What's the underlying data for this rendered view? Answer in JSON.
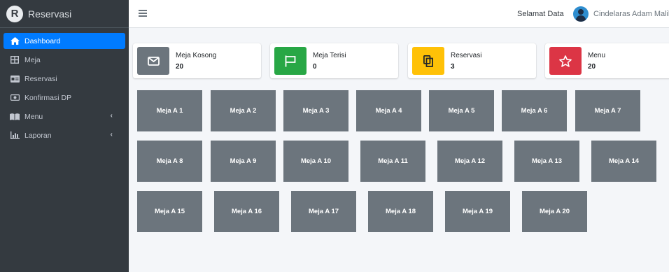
{
  "brand": {
    "logo_letter": "R",
    "name": "Reservasi"
  },
  "sidebar": {
    "items": [
      {
        "label": "Dashboard",
        "icon": "home-icon",
        "active": true
      },
      {
        "label": "Meja",
        "icon": "table-grid-icon"
      },
      {
        "label": "Reservasi",
        "icon": "id-card-icon"
      },
      {
        "label": "Konfirmasi DP",
        "icon": "money-icon"
      },
      {
        "label": "Menu",
        "icon": "book-icon",
        "chevron": "‹"
      },
      {
        "label": "Laporan",
        "icon": "chart-icon",
        "chevron": "‹"
      }
    ]
  },
  "header": {
    "greeting": "Selamat Data",
    "username": "Cindelaras Adam Malik"
  },
  "info_boxes": [
    {
      "label": "Meja Kosong",
      "value": "20",
      "icon": "envelope-icon",
      "color": "#6c757d"
    },
    {
      "label": "Meja Terisi",
      "value": "0",
      "icon": "flag-icon",
      "color": "#28a745"
    },
    {
      "label": "Reservasi",
      "value": "3",
      "icon": "copy-icon",
      "color": "#ffc107"
    },
    {
      "label": "Menu",
      "value": "20",
      "icon": "star-icon",
      "color": "#dc3545"
    }
  ],
  "tables": [
    "Meja A 1",
    "Meja A 2",
    "Meja A 3",
    "Meja A 4",
    "Meja A 5",
    "Meja A 6",
    "Meja A 7",
    "Meja A 8",
    "Meja A 9",
    "Meja A 10",
    "Meja A 11",
    "Meja A 12",
    "Meja A 13",
    "Meja A 14",
    "Meja A 15",
    "Meja A 16",
    "Meja A 17",
    "Meja A 18",
    "Meja A 19",
    "Meja A 20"
  ]
}
